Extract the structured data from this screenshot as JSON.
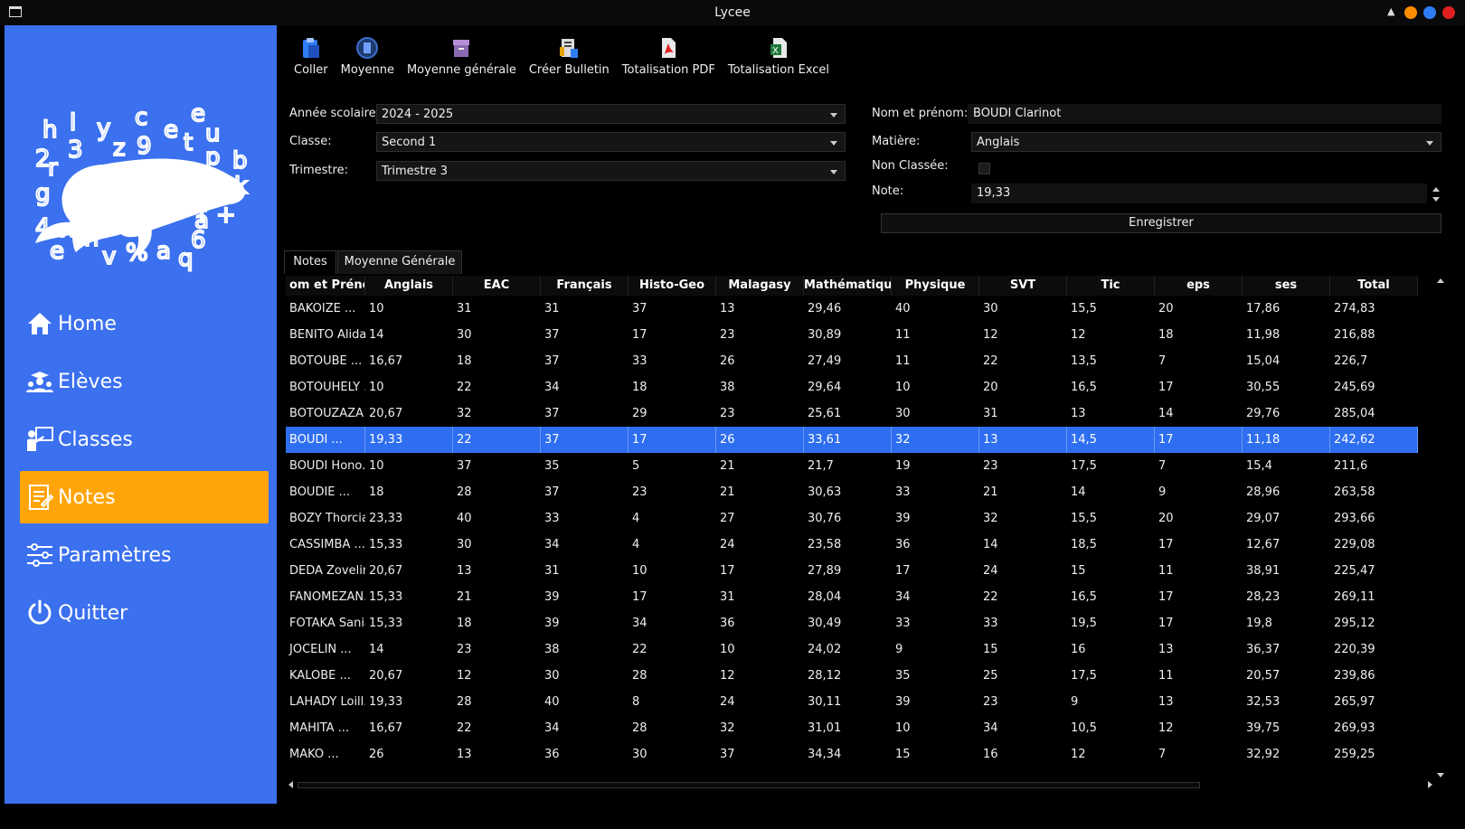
{
  "window": {
    "title": "Lycee",
    "buttons": {
      "minimize_color": "#ff8c00",
      "maximize_color": "#2f7df5",
      "close_color": "#e02020"
    }
  },
  "sidebar": {
    "bg_color": "#3b70ee",
    "active_color": "#ffa50a",
    "logo_letters": [
      "h",
      "l",
      "y",
      "c",
      "e",
      "e",
      "u",
      "2",
      "3",
      "z",
      "9",
      "t",
      "p",
      "b",
      "r",
      "k",
      "g",
      "r",
      "b",
      "f",
      "a",
      "+",
      "4",
      "x",
      "n",
      "6",
      "e",
      "v",
      "%",
      "a",
      "q"
    ],
    "items": [
      {
        "label": "Home",
        "icon": "home-icon"
      },
      {
        "label": "Elèves",
        "icon": "students-icon"
      },
      {
        "label": "Classes",
        "icon": "classes-icon"
      },
      {
        "label": "Notes",
        "icon": "notes-icon",
        "active": true
      },
      {
        "label": "Paramètres",
        "icon": "sliders-icon"
      },
      {
        "label": "Quitter",
        "icon": "power-icon"
      }
    ]
  },
  "toolbar": {
    "items": [
      {
        "label": "Coller",
        "icon": "paste-icon"
      },
      {
        "label": "Moyenne",
        "icon": "calculator-icon"
      },
      {
        "label": "Moyenne générale",
        "icon": "archive-icon"
      },
      {
        "label": "Créer Bulletin",
        "icon": "bulletin-icon"
      },
      {
        "label": "Totalisation PDF",
        "icon": "pdf-icon"
      },
      {
        "label": "Totalisation Excel",
        "icon": "excel-icon"
      }
    ]
  },
  "filters": {
    "annee_label": "Année scolaire",
    "annee_value": "2024 - 2025",
    "classe_label": "Classe:",
    "classe_value": "Second 1",
    "trimestre_label": "Trimestre:",
    "trimestre_value": "Trimestre 3"
  },
  "student_form": {
    "nom_label": "Nom et prénom:",
    "nom_value": "BOUDI Clarinot",
    "matiere_label": "Matière:",
    "matiere_value": "Anglais",
    "non_classee_label": "Non Classée:",
    "note_label": "Note:",
    "note_value": "19,33",
    "save_label": "Enregistrer"
  },
  "tabs": [
    {
      "label": "Notes",
      "active": true
    },
    {
      "label": "Moyenne Générale",
      "active": false
    }
  ],
  "table": {
    "columns": [
      "om et Prénoı",
      "Anglais",
      "EAC",
      "Français",
      "Histo-Geo",
      "Malagasy",
      "Mathématiques",
      "Physique",
      "SVT",
      "Tic",
      "eps",
      "ses",
      "Total"
    ],
    "rows": [
      [
        "BAKOIZE ...",
        "10",
        "31",
        "31",
        "37",
        "13",
        "29,46",
        "40",
        "30",
        "15,5",
        "20",
        "17,86",
        "274,83"
      ],
      [
        "BENITO Alida",
        "14",
        "30",
        "37",
        "17",
        "23",
        "30,89",
        "11",
        "12",
        "12",
        "18",
        "11,98",
        "216,88"
      ],
      [
        "BOTOUBE ...",
        "16,67",
        "18",
        "37",
        "33",
        "26",
        "27,49",
        "11",
        "22",
        "13,5",
        "7",
        "15,04",
        "226,7"
      ],
      [
        "BOTOUHELY ...",
        "10",
        "22",
        "34",
        "18",
        "38",
        "29,64",
        "10",
        "20",
        "16,5",
        "17",
        "30,55",
        "245,69"
      ],
      [
        "BOTOUZAZA ...",
        "20,67",
        "32",
        "37",
        "29",
        "23",
        "25,61",
        "30",
        "31",
        "13",
        "14",
        "29,76",
        "285,04"
      ],
      [
        "BOUDI ...",
        "19,33",
        "22",
        "37",
        "17",
        "26",
        "33,61",
        "32",
        "13",
        "14,5",
        "17",
        "11,18",
        "242,62"
      ],
      [
        "BOUDI Hono...",
        "10",
        "37",
        "35",
        "5",
        "21",
        "21,7",
        "19",
        "23",
        "17,5",
        "7",
        "15,4",
        "211,6"
      ],
      [
        "BOUDIE ...",
        "18",
        "28",
        "37",
        "23",
        "21",
        "30,63",
        "33",
        "21",
        "14",
        "9",
        "28,96",
        "263,58"
      ],
      [
        "BOZY Thorcia",
        "23,33",
        "40",
        "33",
        "4",
        "27",
        "30,76",
        "39",
        "32",
        "15,5",
        "20",
        "29,07",
        "293,66"
      ],
      [
        "CASSIMBA ...",
        "15,33",
        "30",
        "34",
        "4",
        "24",
        "23,58",
        "36",
        "14",
        "18,5",
        "17",
        "12,67",
        "229,08"
      ],
      [
        "DEDA Zovelin",
        "20,67",
        "13",
        "31",
        "10",
        "17",
        "27,89",
        "17",
        "24",
        "15",
        "11",
        "38,91",
        "225,47"
      ],
      [
        "FANOMEZAN...",
        "15,33",
        "21",
        "39",
        "17",
        "31",
        "28,04",
        "34",
        "22",
        "16,5",
        "17",
        "28,23",
        "269,11"
      ],
      [
        "FOTAKA Sania",
        "15,33",
        "18",
        "39",
        "34",
        "36",
        "30,49",
        "33",
        "33",
        "19,5",
        "17",
        "19,8",
        "295,12"
      ],
      [
        "JOCELIN ...",
        "14",
        "23",
        "38",
        "22",
        "10",
        "24,02",
        "9",
        "15",
        "16",
        "13",
        "36,37",
        "220,39"
      ],
      [
        "KALOBE ...",
        "20,67",
        "12",
        "30",
        "28",
        "12",
        "28,12",
        "35",
        "25",
        "17,5",
        "11",
        "20,57",
        "239,86"
      ],
      [
        "LAHADY Loill...",
        "19,33",
        "28",
        "40",
        "8",
        "24",
        "30,11",
        "39",
        "23",
        "9",
        "13",
        "32,53",
        "265,97"
      ],
      [
        "MAHITA ...",
        "16,67",
        "22",
        "34",
        "28",
        "32",
        "31,01",
        "10",
        "34",
        "10,5",
        "12",
        "39,75",
        "269,93"
      ],
      [
        "MAKO ...",
        "26",
        "13",
        "36",
        "30",
        "37",
        "34,34",
        "15",
        "16",
        "12",
        "7",
        "32,92",
        "259,25"
      ]
    ],
    "selected_row": 5
  }
}
